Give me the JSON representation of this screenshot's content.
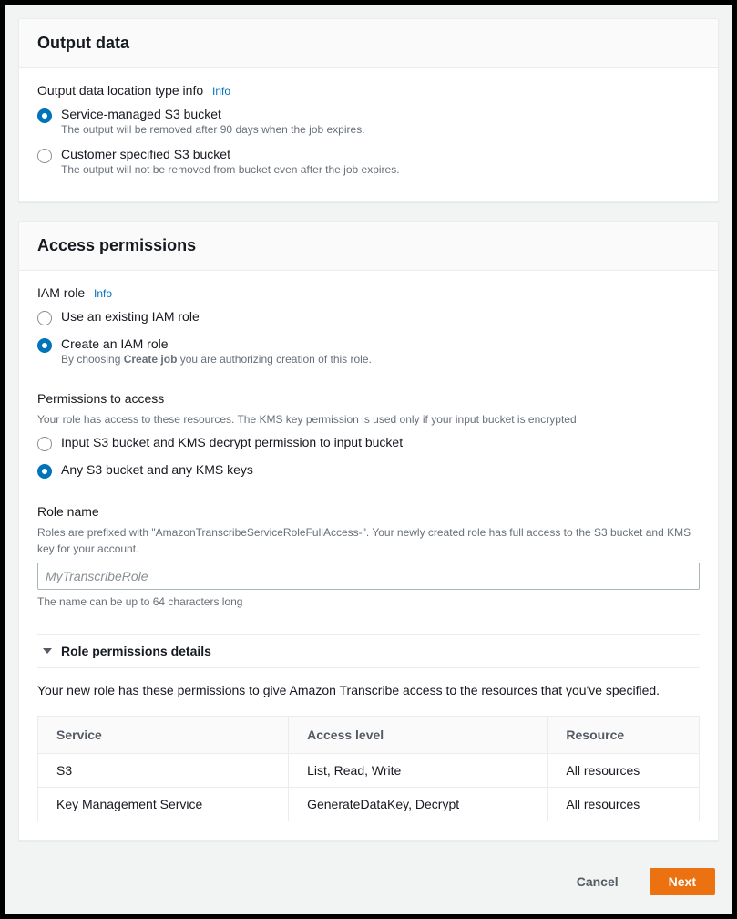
{
  "outputData": {
    "title": "Output data",
    "locationLabel": "Output data location type info",
    "info": "Info",
    "options": [
      {
        "label": "Service-managed S3 bucket",
        "desc": "The output will be removed after 90 days when the job expires.",
        "selected": true
      },
      {
        "label": "Customer specified S3 bucket",
        "desc": "The output will not be removed from bucket even after the job expires.",
        "selected": false
      }
    ]
  },
  "access": {
    "title": "Access permissions",
    "iamRoleLabel": "IAM role",
    "info": "Info",
    "roleOptions": [
      {
        "label": "Use an existing IAM role",
        "desc": "",
        "selected": false
      },
      {
        "label": "Create an IAM role",
        "descPrefix": "By choosing ",
        "descBold": "Create job",
        "descSuffix": " you are authorizing creation of this role.",
        "selected": true
      }
    ],
    "permLabel": "Permissions to access",
    "permHelper": "Your role has access to these resources. The KMS key permission is used only if your input bucket is encrypted",
    "permOptions": [
      {
        "label": "Input S3 bucket and KMS decrypt permission to input bucket",
        "selected": false
      },
      {
        "label": "Any S3 bucket and any KMS keys",
        "selected": true
      }
    ],
    "roleNameLabel": "Role name",
    "roleNameHelper": "Roles are prefixed with \"AmazonTranscribeServiceRoleFullAccess-\". Your newly created role has full access to the S3 bucket and KMS key for your account.",
    "roleNamePlaceholder": "MyTranscribeRole",
    "roleNameConstraint": "The name can be up to 64 characters long",
    "expanderLabel": "Role permissions details",
    "permDesc": "Your new role has these permissions to give Amazon Transcribe access to the resources that you've specified.",
    "tableHeaders": {
      "service": "Service",
      "access": "Access level",
      "resource": "Resource"
    },
    "tableRows": [
      {
        "service": "S3",
        "access": "List, Read, Write",
        "resource": "All resources"
      },
      {
        "service": "Key Management Service",
        "access": "GenerateDataKey, Decrypt",
        "resource": "All resources"
      }
    ]
  },
  "footer": {
    "cancel": "Cancel",
    "next": "Next"
  }
}
